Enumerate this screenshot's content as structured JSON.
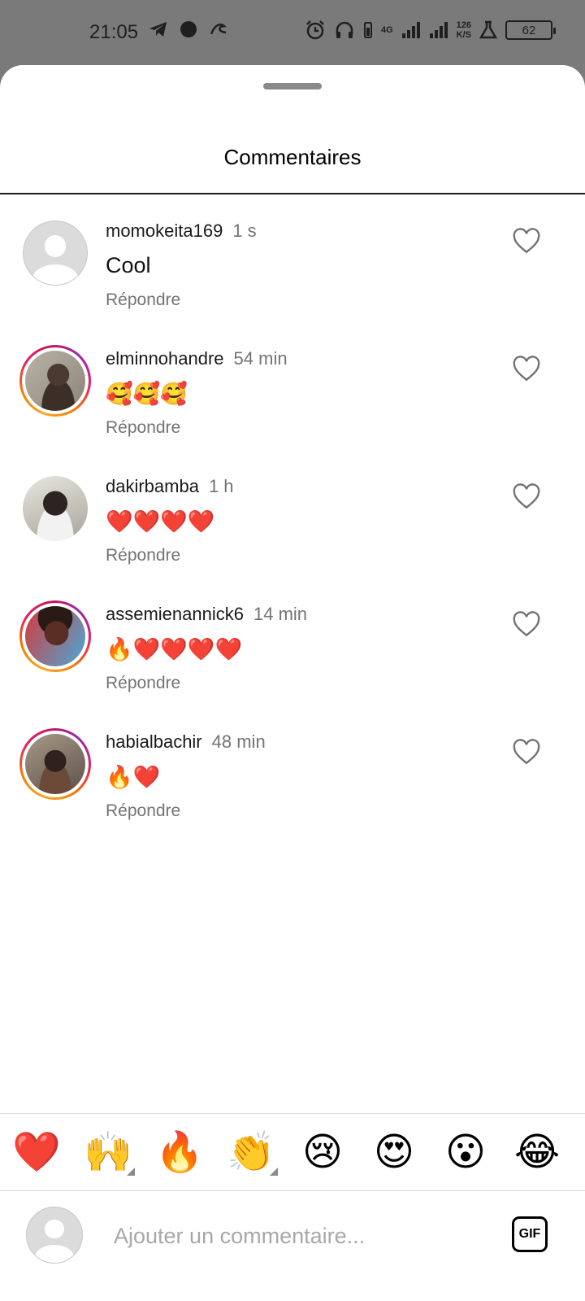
{
  "status_bar": {
    "time": "21:05",
    "network": "4G",
    "speed_value": "126",
    "speed_unit": "K/S",
    "battery": "62"
  },
  "sheet": {
    "title": "Commentaires"
  },
  "comments": [
    {
      "username": "momokeita169",
      "time": "1 s",
      "text": "Cool",
      "reply_label": "Répondre",
      "avatar": "default",
      "story_ring": false
    },
    {
      "username": "elminnohandre",
      "time": "54 min",
      "text": "🥰🥰🥰",
      "reply_label": "Répondre",
      "avatar": "photo",
      "story_ring": true
    },
    {
      "username": "dakirbamba",
      "time": "1 h",
      "text": "❤️❤️❤️❤️",
      "reply_label": "Répondre",
      "avatar": "photo",
      "story_ring": false
    },
    {
      "username": "assemienannick6",
      "time": "14 min",
      "text": "🔥❤️❤️❤️❤️",
      "reply_label": "Répondre",
      "avatar": "photo",
      "story_ring": true
    },
    {
      "username": "habialbachir",
      "time": "48 min",
      "text": "🔥❤️",
      "reply_label": "Répondre",
      "avatar": "photo",
      "story_ring": true
    }
  ],
  "emoji_bar": [
    "❤️",
    "🙌",
    "🔥",
    "👏",
    "😢",
    "😍",
    "😮",
    "😂"
  ],
  "input": {
    "placeholder": "Ajouter un commentaire...",
    "value": "",
    "gif_label": "GIF"
  },
  "colors": {
    "ring_start": "#f9a825",
    "ring_end": "#c2185b",
    "secondary_text": "#737373"
  }
}
